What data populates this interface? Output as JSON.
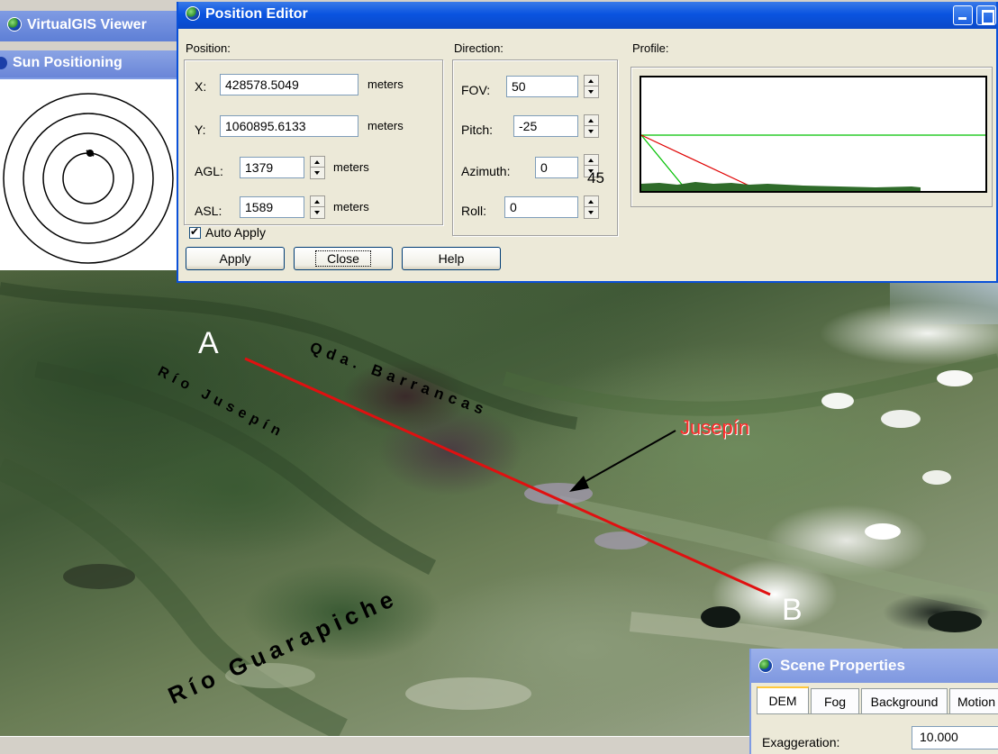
{
  "background_windows": {
    "virtualgis_title": "VirtualGIS Viewer",
    "sun_positioning_title": "Sun Positioning"
  },
  "position_editor": {
    "title": "Position Editor",
    "position_group": {
      "label": "Position:",
      "x": {
        "label": "X:",
        "value": "428578.5049",
        "unit": "meters"
      },
      "y": {
        "label": "Y:",
        "value": "1060895.6133",
        "unit": "meters"
      },
      "agl": {
        "label": "AGL:",
        "value": "1379",
        "unit": "meters"
      },
      "asl": {
        "label": "ASL:",
        "value": "1589",
        "unit": "meters"
      }
    },
    "direction_group": {
      "label": "Direction:",
      "fov": {
        "label": "FOV:",
        "value": "50"
      },
      "pitch": {
        "label": "Pitch:",
        "value": "-25"
      },
      "azimuth": {
        "label": "Azimuth:",
        "value": "0",
        "overlay": "45"
      },
      "roll": {
        "label": "Roll:",
        "value": "0"
      }
    },
    "profile_group": {
      "label": "Profile:"
    },
    "auto_apply": {
      "label": "Auto Apply",
      "checked": true
    },
    "buttons": {
      "apply": "Apply",
      "close": "Close",
      "help": "Help"
    }
  },
  "viewport": {
    "labels": {
      "qda_barrancas": "Qda. Barrancas",
      "rio_jusepin": "Río Jusepín",
      "jusepin_town": "Jusepín",
      "rio_guarapiche": "Río Guarapiche"
    },
    "markers": {
      "a": "A",
      "b": "B"
    },
    "colors": {
      "section_line": "#e01010",
      "town_label": "#ff2a2a"
    }
  },
  "scene_properties": {
    "title": "Scene Properties",
    "tabs": [
      "DEM",
      "Fog",
      "Background",
      "Motion"
    ],
    "exaggeration": {
      "label": "Exaggeration:",
      "value": "10.000"
    }
  }
}
